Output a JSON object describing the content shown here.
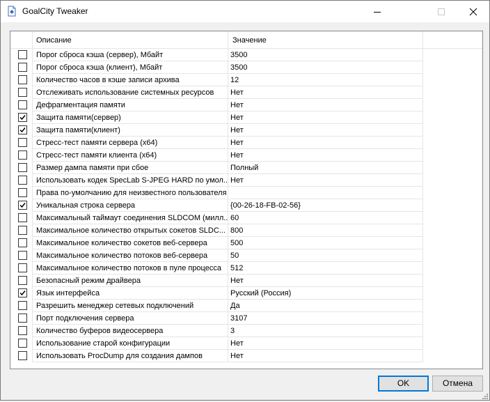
{
  "window": {
    "title": "GoalCity Tweaker"
  },
  "table": {
    "headers": {
      "description": "Описание",
      "value": "Значение"
    },
    "rows": [
      {
        "checked": false,
        "description": "Порог сброса кэша (сервер), Мбайт",
        "value": "3500"
      },
      {
        "checked": false,
        "description": "Порог сброса кэша (клиент), Мбайт",
        "value": "3500"
      },
      {
        "checked": false,
        "description": "Количество часов в кэше записи архива",
        "value": "12"
      },
      {
        "checked": false,
        "description": "Отслеживать использование системных ресурсов",
        "value": "Нет"
      },
      {
        "checked": false,
        "description": "Дефрагментация памяти",
        "value": "Нет"
      },
      {
        "checked": true,
        "description": "Защита памяти(сервер)",
        "value": "Нет"
      },
      {
        "checked": true,
        "description": "Защита памяти(клиент)",
        "value": "Нет"
      },
      {
        "checked": false,
        "description": "Стресс-тест памяти сервера (x64)",
        "value": "Нет"
      },
      {
        "checked": false,
        "description": "Стресс-тест памяти клиента (x64)",
        "value": "Нет"
      },
      {
        "checked": false,
        "description": "Размер дампа памяти при сбое",
        "value": "Полный"
      },
      {
        "checked": false,
        "description": "Использовать кодек SpecLab S-JPEG HARD по умол...",
        "value": "Нет"
      },
      {
        "checked": false,
        "description": "Права по-умолчанию для неизвестного пользователя",
        "value": ""
      },
      {
        "checked": true,
        "description": "Уникальная строка сервера",
        "value": "{00-26-18-FB-02-56}"
      },
      {
        "checked": false,
        "description": "Максимальный таймаут соединения SLDCOM (милл...",
        "value": "60"
      },
      {
        "checked": false,
        "description": "Максимальное количество открытых сокетов SLDC...",
        "value": "800"
      },
      {
        "checked": false,
        "description": "Максимальное количество сокетов веб-сервера",
        "value": "500"
      },
      {
        "checked": false,
        "description": "Максимальное количество потоков веб-сервера",
        "value": "50"
      },
      {
        "checked": false,
        "description": "Максимальное количество потоков в пуле процесса",
        "value": "512"
      },
      {
        "checked": false,
        "description": "Безопасный режим драйвера",
        "value": "Нет"
      },
      {
        "checked": true,
        "description": "Язык интерфейса",
        "value": "Русский (Россия)"
      },
      {
        "checked": false,
        "description": "Разрешить менеджер сетевых подключений",
        "value": "Да"
      },
      {
        "checked": false,
        "description": "Порт подключения сервера",
        "value": "3107"
      },
      {
        "checked": false,
        "description": "Количество буферов видеосервера",
        "value": "3"
      },
      {
        "checked": false,
        "description": "Использование старой конфигурации",
        "value": "Нет"
      },
      {
        "checked": false,
        "description": "Использовать ProcDump для создания дампов",
        "value": "Нет"
      }
    ]
  },
  "buttons": {
    "ok": "OK",
    "cancel": "Отмена"
  },
  "icons": {
    "app": "app-document-icon",
    "minimize": "minimize-icon",
    "maximize": "maximize-icon",
    "close": "close-icon",
    "check": "check-icon",
    "grip": "resize-grip-icon"
  },
  "colors": {
    "accent": "#0078d7",
    "border": "#828790",
    "grid": "#e5e5e5"
  }
}
